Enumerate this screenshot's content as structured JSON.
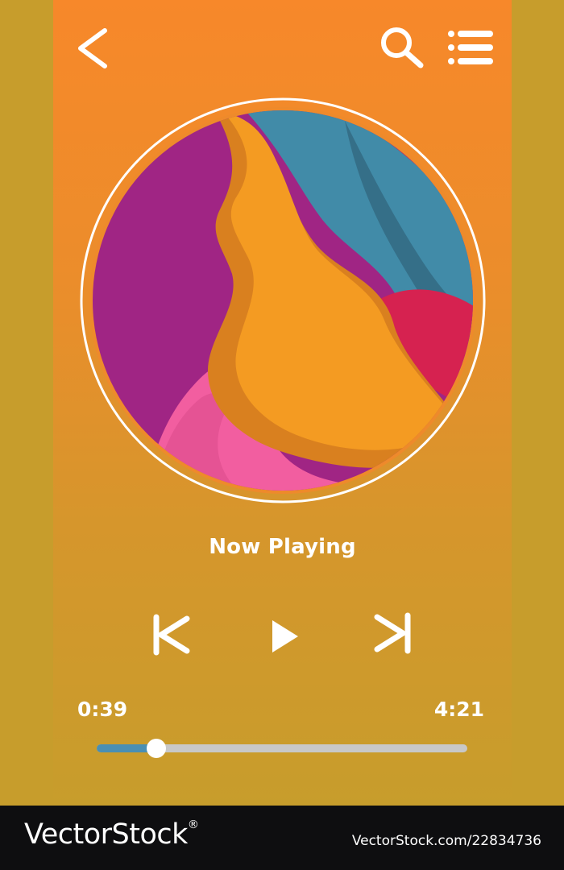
{
  "player": {
    "title": "Now Playing",
    "elapsed": "0:39",
    "duration": "4:21",
    "progress_fraction": 0.16
  },
  "header": {
    "back_icon": "chevron-left-icon",
    "search_icon": "search-icon",
    "menu_icon": "list-menu-icon"
  },
  "controls": {
    "prev_icon": "skip-previous-icon",
    "play_icon": "play-icon",
    "next_icon": "skip-next-icon"
  },
  "colors": {
    "accent_progress": "#4a8fb3",
    "track": "#c8c8c8",
    "background_top": "#f7882a",
    "background_bottom": "#c79d2c"
  },
  "watermark": {
    "brand": "VectorStock",
    "registered_mark": "®",
    "image_id": "VectorStock.com/22834736"
  }
}
